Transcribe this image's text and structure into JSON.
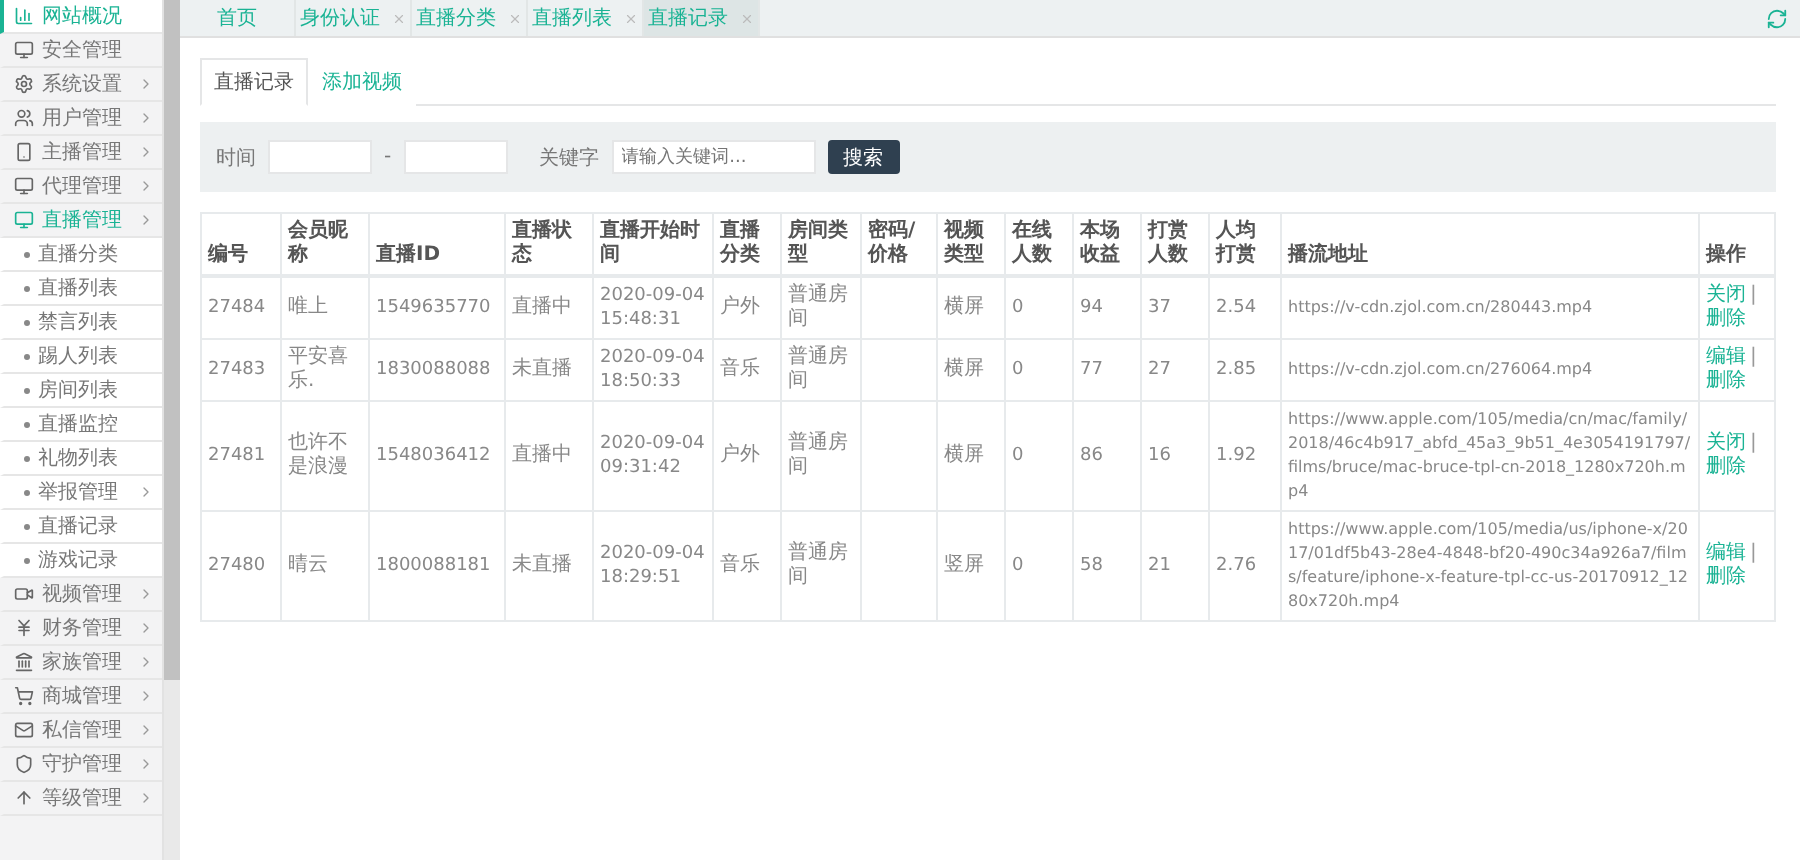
{
  "sidebar": {
    "items": [
      {
        "label": "网站概况",
        "selected": true,
        "expandable": false,
        "expanded": false
      },
      {
        "label": "安全管理",
        "selected": false,
        "expandable": false,
        "expanded": false
      },
      {
        "label": "系统设置",
        "selected": false,
        "expandable": true,
        "expanded": false
      },
      {
        "label": "用户管理",
        "selected": false,
        "expandable": true,
        "expanded": false
      },
      {
        "label": "主播管理",
        "selected": false,
        "expandable": true,
        "expanded": false
      },
      {
        "label": "代理管理",
        "selected": false,
        "expandable": true,
        "expanded": false
      },
      {
        "label": "直播管理",
        "selected": false,
        "expandable": true,
        "expanded": true,
        "children": [
          {
            "label": "直播分类",
            "expandable": false
          },
          {
            "label": "直播列表",
            "expandable": false
          },
          {
            "label": "禁言列表",
            "expandable": false
          },
          {
            "label": "踢人列表",
            "expandable": false
          },
          {
            "label": "房间列表",
            "expandable": false
          },
          {
            "label": "直播监控",
            "expandable": false
          },
          {
            "label": "礼物列表",
            "expandable": false
          },
          {
            "label": "举报管理",
            "expandable": true
          },
          {
            "label": "直播记录",
            "expandable": false
          },
          {
            "label": "游戏记录",
            "expandable": false
          }
        ]
      },
      {
        "label": "视频管理",
        "selected": false,
        "expandable": true,
        "expanded": false
      },
      {
        "label": "财务管理",
        "selected": false,
        "expandable": true,
        "expanded": false
      },
      {
        "label": "家族管理",
        "selected": false,
        "expandable": true,
        "expanded": false
      },
      {
        "label": "商城管理",
        "selected": false,
        "expandable": true,
        "expanded": false
      },
      {
        "label": "私信管理",
        "selected": false,
        "expandable": true,
        "expanded": false
      },
      {
        "label": "守护管理",
        "selected": false,
        "expandable": true,
        "expanded": false
      },
      {
        "label": "等级管理",
        "selected": false,
        "expandable": true,
        "expanded": false
      }
    ]
  },
  "top_tabs": [
    {
      "label": "首页",
      "selected": false,
      "closable": false
    },
    {
      "label": "身份认证",
      "selected": false,
      "closable": true
    },
    {
      "label": "直播分类",
      "selected": false,
      "closable": true
    },
    {
      "label": "直播列表",
      "selected": false,
      "closable": true
    },
    {
      "label": "直播记录",
      "selected": true,
      "closable": true
    }
  ],
  "page_tabs": [
    {
      "label": "直播记录",
      "selected": true
    },
    {
      "label": "添加视频",
      "selected": false
    }
  ],
  "filter": {
    "time_label": "时间",
    "range_separator": "-",
    "keyword_label": "关键字",
    "keyword_placeholder": "请输入关键词...",
    "search_button": "搜索"
  },
  "table": {
    "columns": [
      "编号",
      "会员昵称",
      "直播ID",
      "直播状态",
      "直播开始时间",
      "直播分类",
      "房间类型",
      "密码/价格",
      "视频类型",
      "在线人数",
      "本场收益",
      "打赏人数",
      "人均打赏",
      "播流地址",
      "操作"
    ],
    "action_separator": "|",
    "rows": [
      {
        "cells": [
          "27484",
          "唯上",
          "1549635770",
          "直播中",
          "2020-09-04 15:48:31",
          "户外",
          "普通房间",
          "",
          "横屏",
          "0",
          "94",
          "37",
          "2.54",
          "https://v-cdn.zjol.com.cn/280443.mp4"
        ],
        "actions": [
          "关闭",
          "删除"
        ]
      },
      {
        "cells": [
          "27483",
          "平安喜乐.",
          "1830088088",
          "未直播",
          "2020-09-04 18:50:33",
          "音乐",
          "普通房间",
          "",
          "横屏",
          "0",
          "77",
          "27",
          "2.85",
          "https://v-cdn.zjol.com.cn/276064.mp4"
        ],
        "actions": [
          "编辑",
          "删除"
        ]
      },
      {
        "cells": [
          "27481",
          "也许不是浪漫",
          "1548036412",
          "直播中",
          "2020-09-04 09:31:42",
          "户外",
          "普通房间",
          "",
          "横屏",
          "0",
          "86",
          "16",
          "1.92",
          "https://www.apple.com/105/media/cn/mac/family/2018/46c4b917_abfd_45a3_9b51_4e3054191797/films/bruce/mac-bruce-tpl-cn-2018_1280x720h.mp4"
        ],
        "actions": [
          "关闭",
          "删除"
        ]
      },
      {
        "cells": [
          "27480",
          "晴云",
          "1800088181",
          "未直播",
          "2020-09-04 18:29:51",
          "音乐",
          "普通房间",
          "",
          "竖屏",
          "0",
          "58",
          "21",
          "2.76",
          "https://www.apple.com/105/media/us/iphone-x/2017/01df5b43-28e4-4848-bf20-490c34a926a7/films/feature/iphone-x-feature-tpl-cc-us-20170912_1280x720h.mp4"
        ],
        "actions": [
          "编辑",
          "删除"
        ]
      }
    ]
  }
}
